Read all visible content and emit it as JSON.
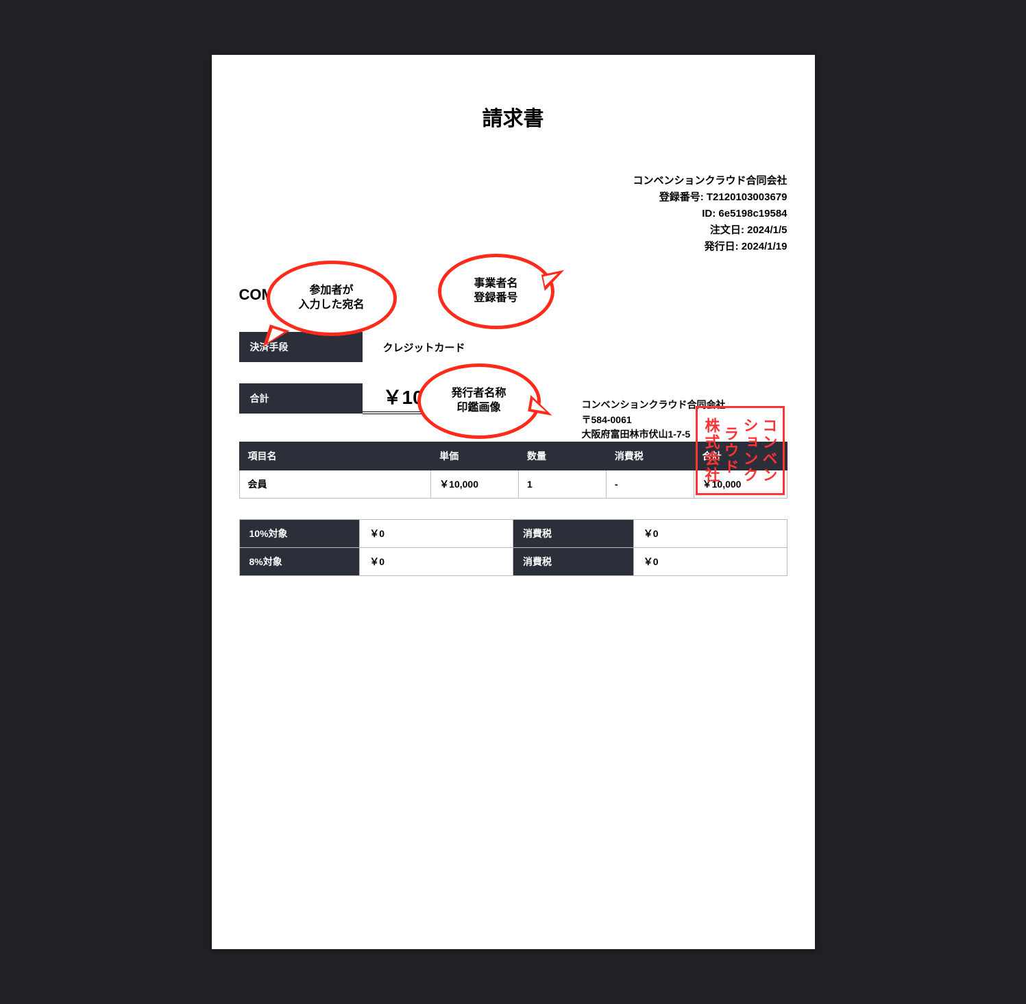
{
  "title": "請求書",
  "header": {
    "company": "コンベンションクラウド合同会社",
    "registration_label": "登録番号",
    "registration_no": "T2120103003679",
    "id_label": "ID",
    "id": "6e5198c19584",
    "order_date_label": "注文日",
    "order_date": "2024/1/5",
    "issue_date_label": "発行日",
    "issue_date": "2024/1/19"
  },
  "recipient": "COMPANY A 様",
  "payment": {
    "label": "決済手段",
    "value": "クレジットカード"
  },
  "total": {
    "label": "合計",
    "value": "￥10,000"
  },
  "issuer": {
    "name": "コンベンションクラウド合同会社",
    "postal": "〒584-0061",
    "address": "大阪府富田林市伏山1-7-5"
  },
  "stamp": {
    "col1": "コンベン",
    "col2": "ションク",
    "col3": "ラウド",
    "col4": "株式会社"
  },
  "items": {
    "headers": [
      "項目名",
      "単価",
      "数量",
      "消費税",
      "合計"
    ],
    "rows": [
      {
        "c0": "会員",
        "c1": "￥10,000",
        "c2": "1",
        "c3": "-",
        "c4": "￥10,000"
      }
    ]
  },
  "tax": {
    "r1": {
      "h1": "10%対象",
      "v1": "￥0",
      "h2": "消費税",
      "v2": "￥0"
    },
    "r2": {
      "h1": "8%対象",
      "v1": "￥0",
      "h2": "消費税",
      "v2": "￥0"
    }
  },
  "annotations": {
    "b1": "参加者が\n入力した宛名",
    "b2": "事業者名\n登録番号",
    "b3": "発行者名称\n印鑑画像"
  }
}
